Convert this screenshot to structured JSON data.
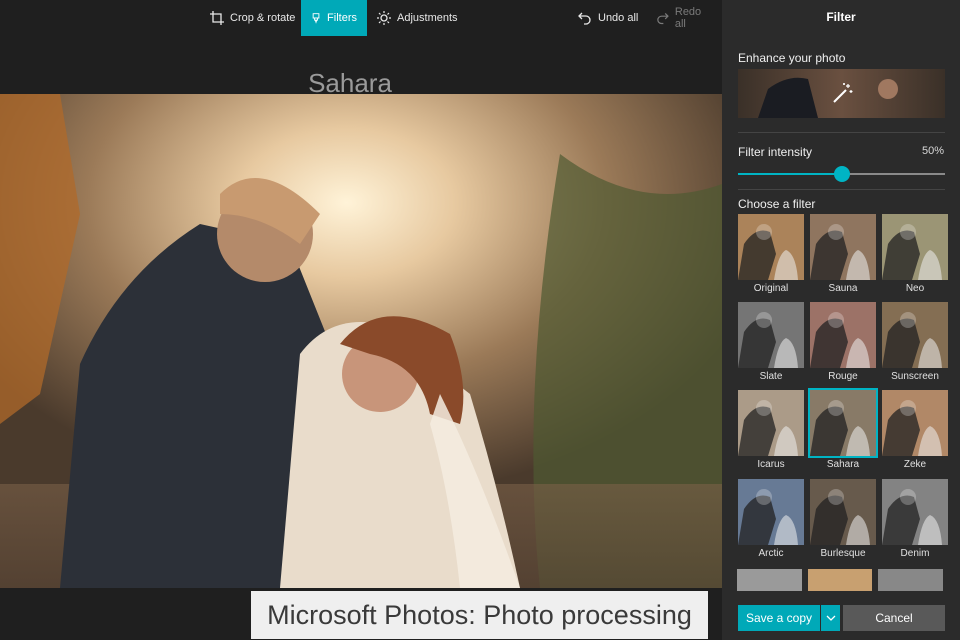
{
  "toolbar": {
    "crop_label": "Crop & rotate",
    "filters_label": "Filters",
    "adjustments_label": "Adjustments",
    "undo_label": "Undo all",
    "redo_label": "Redo all"
  },
  "preview": {
    "filter_name": "Sahara"
  },
  "caption": "Microsoft Photos: Photo processing",
  "panel": {
    "title": "Filter",
    "enhance_label": "Enhance your photo",
    "intensity_label": "Filter intensity",
    "intensity_value": "50%",
    "intensity_fraction": 0.5,
    "choose_label": "Choose a filter",
    "filters": [
      {
        "name": "Original",
        "selected": false,
        "tone": "#c99a6a"
      },
      {
        "name": "Sauna",
        "selected": false,
        "tone": "#a88a70"
      },
      {
        "name": "Neo",
        "selected": false,
        "tone": "#b7b08a"
      },
      {
        "name": "Slate",
        "selected": false,
        "tone": "#8a8a8a"
      },
      {
        "name": "Rouge",
        "selected": false,
        "tone": "#b8867a"
      },
      {
        "name": "Sunscreen",
        "selected": false,
        "tone": "#9c8262"
      },
      {
        "name": "Icarus",
        "selected": false,
        "tone": "#c9b7a0"
      },
      {
        "name": "Sahara",
        "selected": true,
        "tone": "#a0907a"
      },
      {
        "name": "Zeke",
        "selected": false,
        "tone": "#d0a07a"
      },
      {
        "name": "Arctic",
        "selected": false,
        "tone": "#7a90b0"
      },
      {
        "name": "Burlesque",
        "selected": false,
        "tone": "#7a6a5a"
      },
      {
        "name": "Denim",
        "selected": false,
        "tone": "#9a9a9a"
      }
    ],
    "save_label": "Save a copy",
    "cancel_label": "Cancel"
  },
  "colors": {
    "accent": "#00a9b8",
    "panel_bg": "#2b2b2b",
    "app_bg": "#1f1f1f"
  }
}
